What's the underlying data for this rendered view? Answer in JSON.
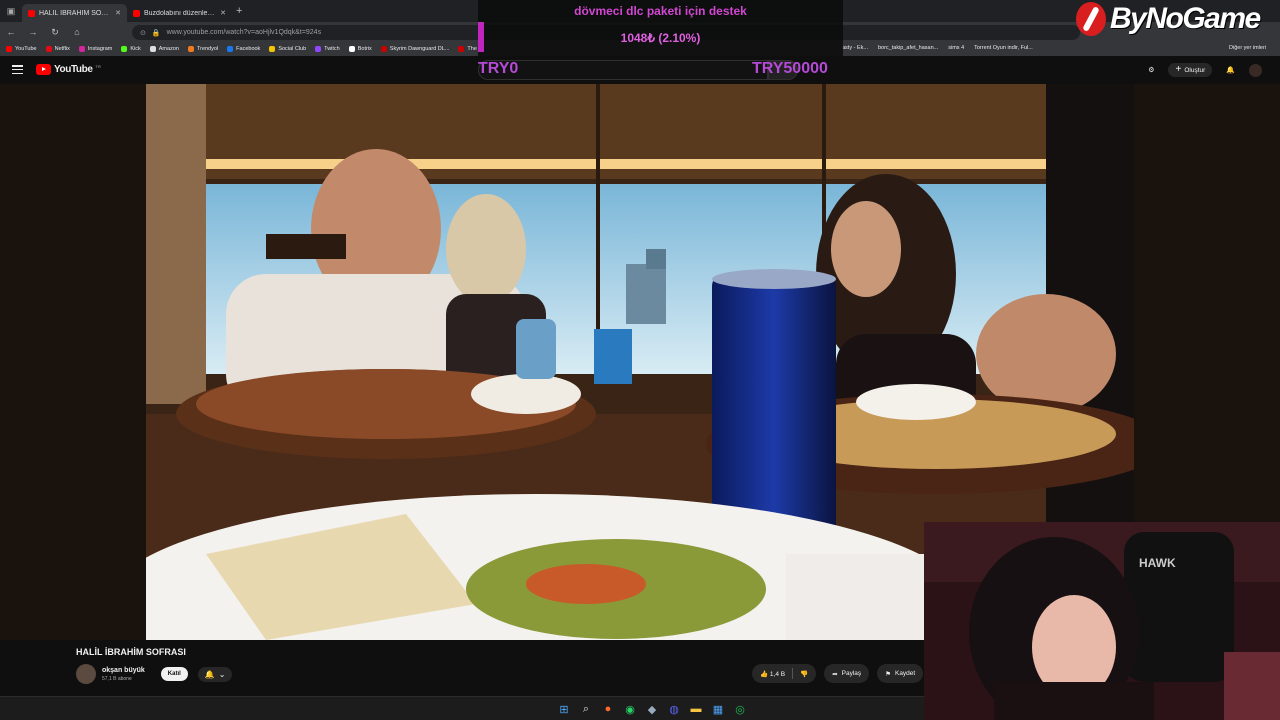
{
  "browser": {
    "tabs": [
      {
        "title": "HALİL İBRAHİM SOFRASI - YouTube",
        "active": true
      },
      {
        "title": "Buzdolabını düzenleyin - YouTube",
        "active": false
      }
    ],
    "url": "www.youtube.com/watch?v=aoHjlv1Qdqk&t=924s",
    "bookmarks": [
      "YouTube",
      "Netflix",
      "Instagram",
      "Kick",
      "Amazon",
      "Trendyol",
      "Facebook",
      "Social Club",
      "Twitch",
      "Botrix",
      "Skyrim Dawnguard DL...",
      "The E"
    ],
    "bookmarks_right": [
      "asty - Ek...",
      "borc_takip_afet_hasan...",
      "sims 4",
      "Torrent Oyun indir, Ful..."
    ],
    "other_bookmarks": "Diğer yer imleri"
  },
  "overlay": {
    "donation_title": "dövmeci dlc paketi için destek",
    "donation_amount": "1048₺ (2.10%)",
    "donation_progress_fraction": 0.021,
    "goal_start": "TRY0",
    "goal_end": "TRY50000",
    "brand_name": "ByNoGame"
  },
  "youtube": {
    "logo_text": "YouTube",
    "logo_country": "TR",
    "create_label": "Oluştur",
    "video_title": "HALİL İBRAHİM SOFRASI",
    "channel_name": "okşan büyük",
    "channel_subs": "57,1 B abone",
    "join_label": "Katıl",
    "like_count": "1,4 B",
    "share_label": "Paylaş",
    "save_label": "Kaydet"
  },
  "webcam_text": "HAWK"
}
